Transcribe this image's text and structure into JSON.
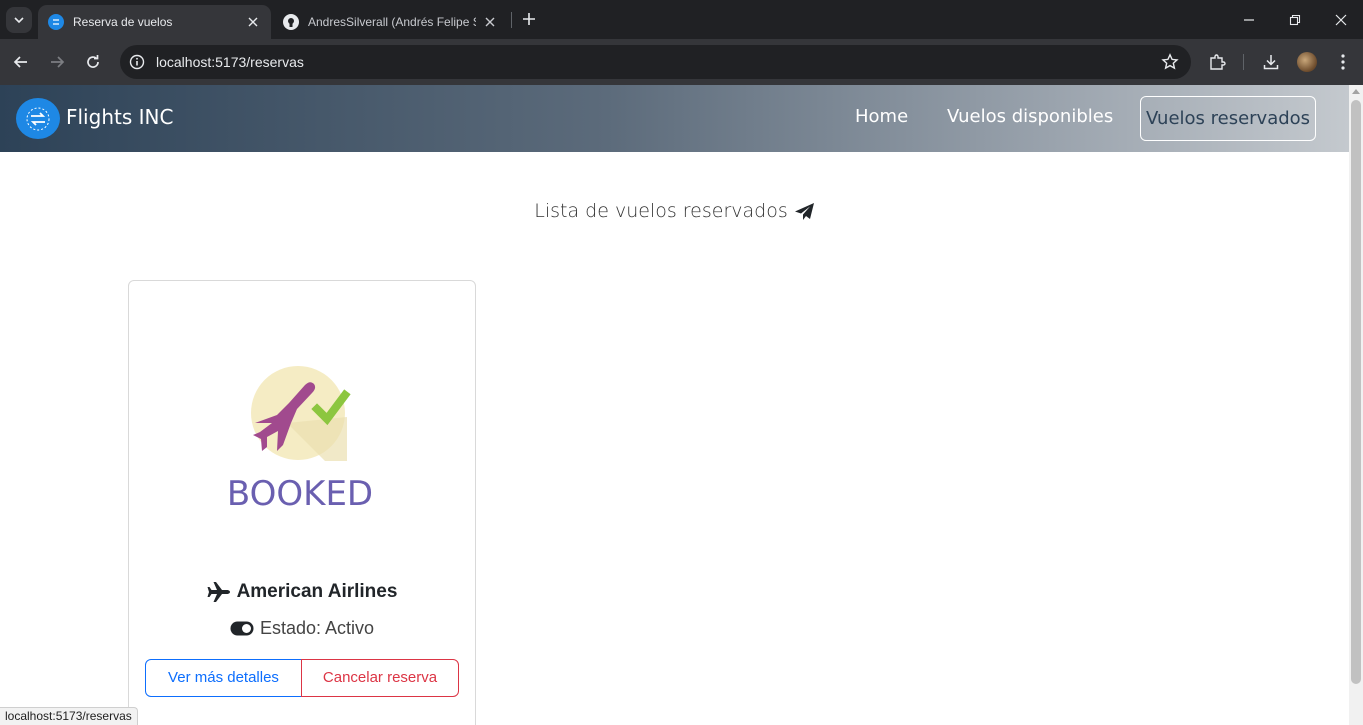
{
  "browser": {
    "tabs": [
      {
        "title": "Reserva de vuelos",
        "active": true
      },
      {
        "title": "AndresSilverall (Andrés Felipe S",
        "active": false
      }
    ],
    "url": "localhost:5173/reservas",
    "status_bar_url": "localhost:5173/reservas"
  },
  "navbar": {
    "brand": "Flights INC",
    "links": [
      {
        "label": "Home"
      },
      {
        "label": "Vuelos disponibles"
      },
      {
        "label": "Vuelos reservados",
        "active": true
      }
    ]
  },
  "main": {
    "heading": "Lista de vuelos reservados",
    "reservations": [
      {
        "image_text": "BOOKED",
        "airline": "American Airlines",
        "status": "Estado: Activo",
        "details_button": "Ver más detalles",
        "cancel_button": "Cancelar reserva"
      }
    ]
  },
  "colors": {
    "primary": "#0d6efd",
    "danger": "#dc3545",
    "booked_text": "#6a5fb0",
    "plane": "#a14a8e",
    "check": "#8cc63f"
  }
}
